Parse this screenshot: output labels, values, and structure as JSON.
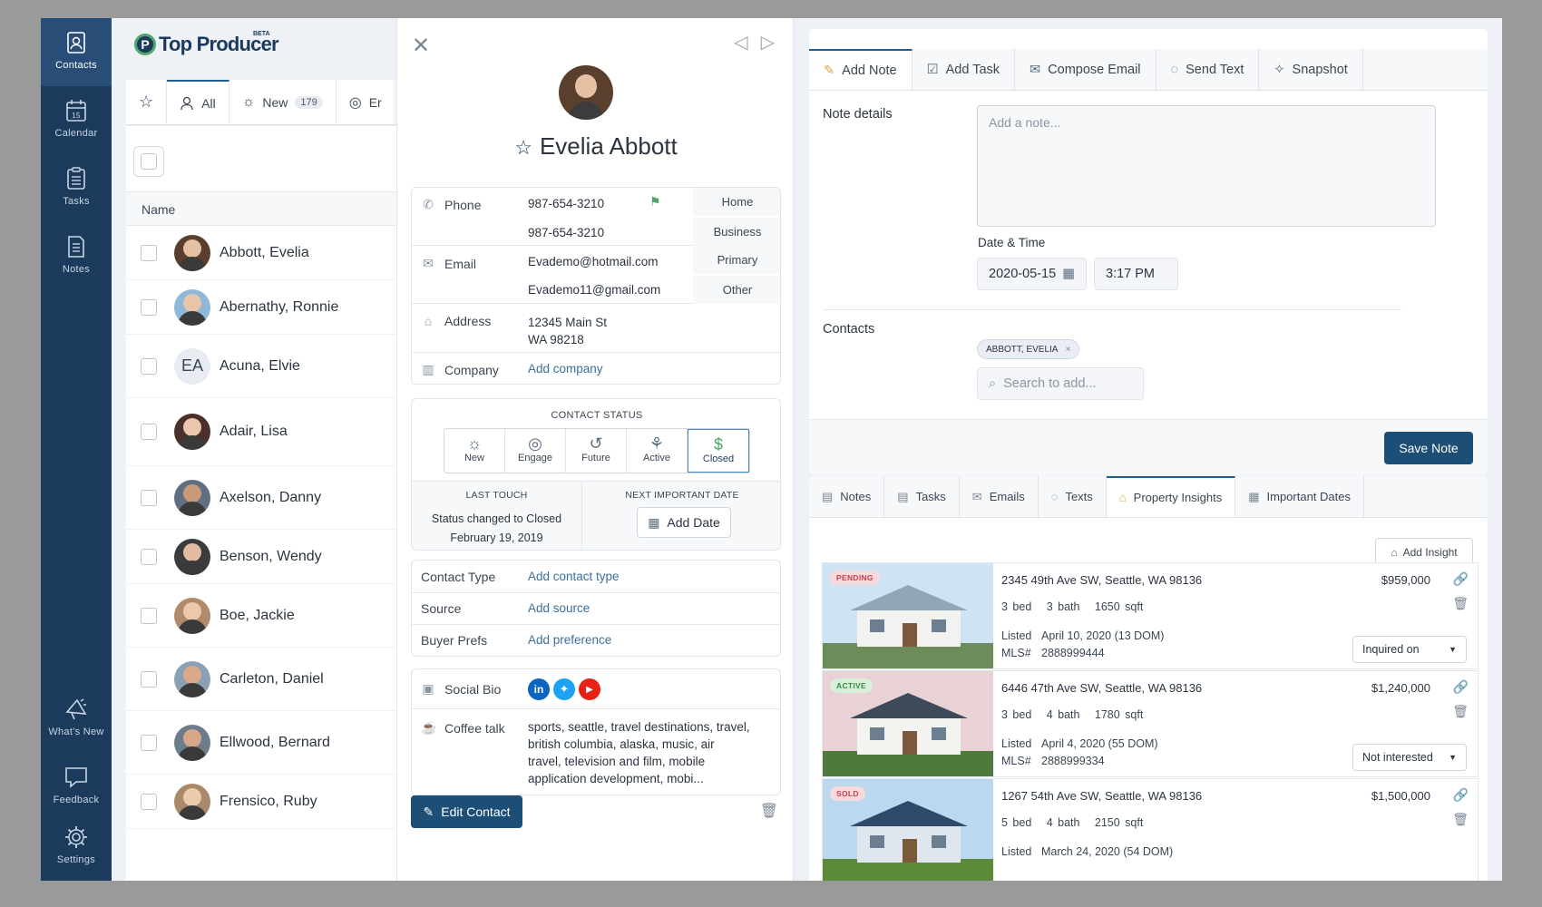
{
  "nav": {
    "items": [
      {
        "label": "Contacts",
        "icon": "contacts-icon"
      },
      {
        "label": "Calendar",
        "icon": "calendar-icon"
      },
      {
        "label": "Tasks",
        "icon": "tasks-icon"
      },
      {
        "label": "Notes",
        "icon": "notes-icon"
      }
    ],
    "bottom": [
      {
        "label": "What's New",
        "icon": "megaphone-icon"
      },
      {
        "label": "Feedback",
        "icon": "feedback-icon"
      },
      {
        "label": "Settings",
        "icon": "gear-icon"
      }
    ]
  },
  "brand": {
    "name": "Top Producer",
    "mark": "P",
    "badge": "BETA"
  },
  "list": {
    "tabs": [
      {
        "label": "All"
      },
      {
        "label": "New",
        "count": "179"
      },
      {
        "label": "Er"
      }
    ],
    "column_header": "Name",
    "contacts": [
      {
        "name": "Abbott, Evelia"
      },
      {
        "name": "Abernathy, Ronnie"
      },
      {
        "name": "Acuna, Elvie",
        "initials": "EA"
      },
      {
        "name": "Adair, Lisa"
      },
      {
        "name": "Axelson, Danny"
      },
      {
        "name": "Benson, Wendy"
      },
      {
        "name": "Boe, Jackie"
      },
      {
        "name": "Carleton, Daniel"
      },
      {
        "name": "Ellwood, Bernard"
      },
      {
        "name": "Frensico, Ruby"
      }
    ]
  },
  "detail": {
    "name": "Evelia Abbott",
    "phone_label": "Phone",
    "phones": [
      {
        "value": "987-654-3210",
        "tag": "Home"
      },
      {
        "value": "987-654-3210",
        "tag": "Business"
      }
    ],
    "email_label": "Email",
    "emails": [
      {
        "value": "Evademo@hotmail.com",
        "tag": "Primary"
      },
      {
        "value": "Evademo11@gmail.com",
        "tag": "Other"
      }
    ],
    "address_label": "Address",
    "address_line1": "12345 Main St",
    "address_line2": "WA 98218",
    "company_label": "Company",
    "company_value": "Add company",
    "status_title": "CONTACT STATUS",
    "statuses": [
      {
        "label": "New"
      },
      {
        "label": "Engage"
      },
      {
        "label": "Future"
      },
      {
        "label": "Active"
      },
      {
        "label": "Closed",
        "selected": true
      }
    ],
    "last_touch_title": "LAST TOUCH",
    "last_touch_line1": "Status changed to Closed",
    "last_touch_line2": "February 19, 2019",
    "next_date_title": "NEXT IMPORTANT DATE",
    "add_date": "Add Date",
    "contact_type_label": "Contact Type",
    "contact_type_value": "Add contact type",
    "source_label": "Source",
    "source_value": "Add source",
    "buyer_prefs_label": "Buyer Prefs",
    "buyer_prefs_value": "Add preference",
    "social_label": "Social Bio",
    "coffee_label": "Coffee talk",
    "coffee_value": "sports, seattle, travel destinations, travel, british columbia, alaska, music, air travel, television and film, mobile application development, mobi...",
    "edit_button": "Edit Contact"
  },
  "note_panel": {
    "tabs": [
      {
        "label": "Add Note",
        "icon": "note-icon"
      },
      {
        "label": "Add Task",
        "icon": "task-icon"
      },
      {
        "label": "Compose Email",
        "icon": "envelope-icon"
      },
      {
        "label": "Send Text",
        "icon": "chat-icon"
      },
      {
        "label": "Snapshot",
        "icon": "snapshot-icon"
      }
    ],
    "details_label": "Note details",
    "note_placeholder": "Add a note...",
    "datetime_label": "Date & Time",
    "date": "2020-05-15",
    "time": "3:17 PM",
    "contacts_label": "Contacts",
    "contact_chip": "ABBOTT, EVELIA",
    "search_placeholder": "Search to add...",
    "save_button": "Save Note"
  },
  "insights": {
    "tabs": [
      {
        "label": "Notes",
        "icon": "notes-icon"
      },
      {
        "label": "Tasks",
        "icon": "tasks-icon"
      },
      {
        "label": "Emails",
        "icon": "envelope-icon"
      },
      {
        "label": "Texts",
        "icon": "chat-icon"
      },
      {
        "label": "Property Insights",
        "icon": "home-icon"
      },
      {
        "label": "Important Dates",
        "icon": "calendar-icon"
      }
    ],
    "add_insight": "Add Insight",
    "listed_label": "Listed",
    "mls_label": "MLS#",
    "properties": [
      {
        "badge": "PENDING",
        "badge_color": "#f8d9dc",
        "badge_text": "#c2424e",
        "address": "2345 49th Ave SW, Seattle, WA 98136",
        "price": "$959,000",
        "beds": "3 bed",
        "baths": "3 bath",
        "sqft": "1650 sqft",
        "listed": "April 10, 2020 (13 DOM)",
        "mls": "2888999444",
        "interest": "Inquired on"
      },
      {
        "badge": "ACTIVE",
        "badge_color": "#d8f0d9",
        "badge_text": "#3b8b46",
        "address": "6446 47th Ave SW, Seattle, WA 98136",
        "price": "$1,240,000",
        "beds": "3 bed",
        "baths": "4 bath",
        "sqft": "1780 sqft",
        "listed": "April 4, 2020 (55 DOM)",
        "mls": "2888999334",
        "interest": "Not interested"
      },
      {
        "badge": "SOLD",
        "badge_color": "#f8d9dc",
        "badge_text": "#c2424e",
        "address": "1267 54th Ave SW, Seattle, WA 98136",
        "price": "$1,500,000",
        "beds": "5 bed",
        "baths": "4 bath",
        "sqft": "2150 sqft",
        "listed": "March 24, 2020 (54 DOM)",
        "mls": "",
        "interest": ""
      }
    ]
  },
  "colors": {
    "rail": "#1c3a5c",
    "accent": "#1c4e76",
    "active_tab": "#e0a340",
    "status_selected": "#4fa66d"
  }
}
